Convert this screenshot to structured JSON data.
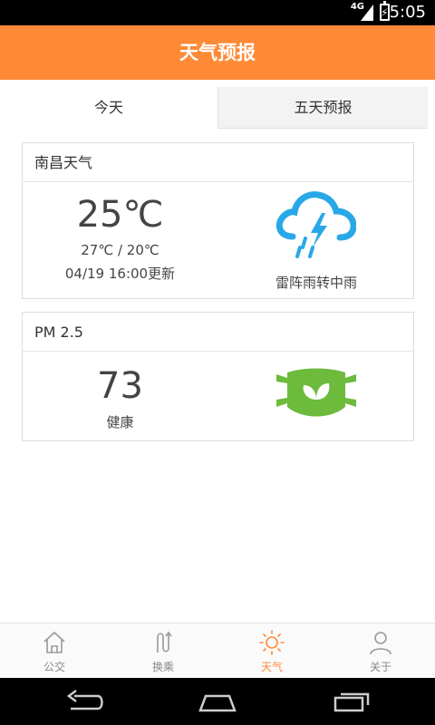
{
  "status_bar": {
    "network": "4G",
    "time": "5:05"
  },
  "app_bar": {
    "title": "天气预报"
  },
  "tabs": [
    {
      "label": "今天",
      "active": true
    },
    {
      "label": "五天预报",
      "active": false
    }
  ],
  "weather_card": {
    "city_title": "南昌天气",
    "current_temp": "25℃",
    "temp_range": "27℃ / 20℃",
    "updated": "04/19 16:00更新",
    "condition": "雷阵雨转中雨",
    "icon": "thunderstorm-rain-icon",
    "icon_color": "#29a8e8"
  },
  "pm_card": {
    "title": "PM 2.5",
    "value": "73",
    "level": "健康",
    "icon": "mask-leaf-icon",
    "icon_color": "#6cbb3c"
  },
  "bottom_nav": [
    {
      "label": "公交",
      "icon": "house-icon",
      "active": false
    },
    {
      "label": "换乘",
      "icon": "transfer-icon",
      "active": false
    },
    {
      "label": "天气",
      "icon": "sun-icon",
      "active": true
    },
    {
      "label": "关于",
      "icon": "user-icon",
      "active": false
    }
  ],
  "colors": {
    "accent": "#ff8a36",
    "inactive_nav": "#888888"
  }
}
